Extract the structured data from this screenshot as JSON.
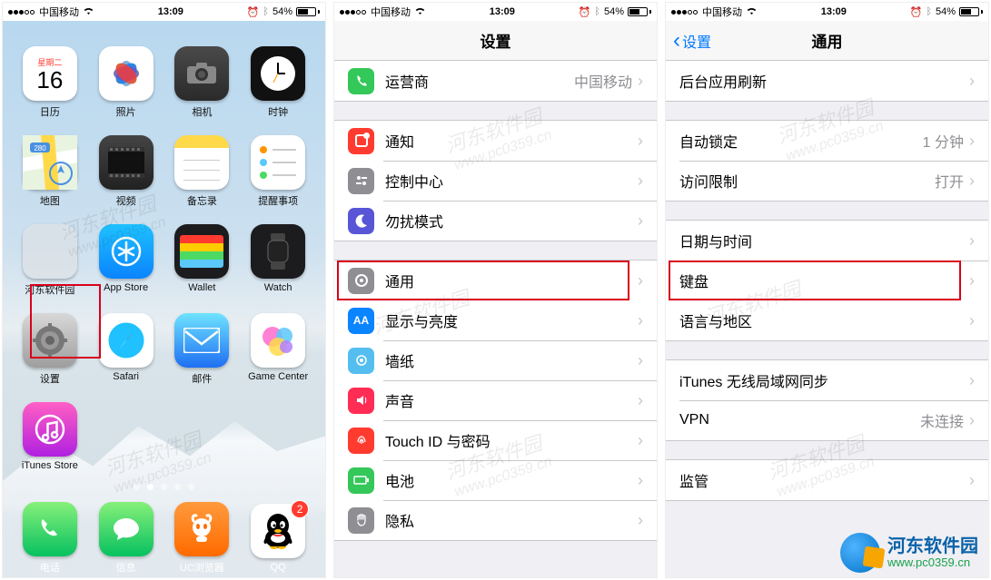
{
  "statusbar": {
    "carrier": "中国移动",
    "time": "13:09",
    "battery_pct": "54%",
    "bt": "⚡︎"
  },
  "screen1": {
    "calendar": {
      "weekday": "星期二",
      "day": "16"
    },
    "apps": [
      {
        "id": "calendar",
        "label": "日历"
      },
      {
        "id": "photos",
        "label": "照片"
      },
      {
        "id": "camera",
        "label": "相机"
      },
      {
        "id": "clock",
        "label": "时钟"
      },
      {
        "id": "maps",
        "label": "地图"
      },
      {
        "id": "videos",
        "label": "视频"
      },
      {
        "id": "notes",
        "label": "备忘录"
      },
      {
        "id": "reminders",
        "label": "提醒事项"
      },
      {
        "id": "folder",
        "label": "河东软件园"
      },
      {
        "id": "appstore",
        "label": "App Store"
      },
      {
        "id": "wallet",
        "label": "Wallet"
      },
      {
        "id": "watch",
        "label": "Watch"
      },
      {
        "id": "settings",
        "label": "设置"
      },
      {
        "id": "safari",
        "label": "Safari"
      },
      {
        "id": "mail",
        "label": "邮件"
      },
      {
        "id": "gamecenter",
        "label": "Game Center"
      },
      {
        "id": "itunes",
        "label": "iTunes Store"
      }
    ],
    "dock": [
      {
        "id": "phone",
        "label": "电话"
      },
      {
        "id": "messages",
        "label": "信息"
      },
      {
        "id": "uc",
        "label": "UC浏览器"
      },
      {
        "id": "qq",
        "label": "QQ",
        "badge": "2"
      }
    ]
  },
  "screen2": {
    "title": "设置",
    "rows": [
      {
        "icon": "carrier",
        "color": "#34c759",
        "label": "运营商",
        "value": "中国移动"
      },
      {
        "icon": "notify",
        "color": "#ff3b30",
        "label": "通知"
      },
      {
        "icon": "control",
        "color": "#8e8e93",
        "label": "控制中心"
      },
      {
        "icon": "dnd",
        "color": "#5856d6",
        "label": "勿扰模式"
      },
      {
        "icon": "general",
        "color": "#8e8e93",
        "label": "通用",
        "hl": true
      },
      {
        "icon": "display",
        "color": "#0a84ff",
        "label": "显示与亮度"
      },
      {
        "icon": "wallpaper",
        "color": "#55bef0",
        "label": "墙纸"
      },
      {
        "icon": "sound",
        "color": "#ff3b30",
        "label": "声音"
      },
      {
        "icon": "touchid",
        "color": "#ff3b30",
        "label": "Touch ID 与密码"
      },
      {
        "icon": "battery",
        "color": "#34c759",
        "label": "电池"
      },
      {
        "icon": "privacy",
        "color": "#8e8e93",
        "label": "隐私"
      }
    ]
  },
  "screen3": {
    "back": "设置",
    "title": "通用",
    "rows": [
      {
        "label": "后台应用刷新"
      },
      {
        "label": "自动锁定",
        "value": "1 分钟"
      },
      {
        "label": "访问限制",
        "value": "打开"
      },
      {
        "label": "日期与时间"
      },
      {
        "label": "键盘",
        "hl": true
      },
      {
        "label": "语言与地区"
      },
      {
        "label": "iTunes 无线局域网同步"
      },
      {
        "label": "VPN",
        "value": "未连接"
      },
      {
        "label": "监管"
      }
    ]
  },
  "watermark": {
    "cn": "河东软件园",
    "url": "www.pc0359.cn"
  },
  "footer": {
    "cn": "河东软件园",
    "url": "www.pc0359.cn"
  }
}
